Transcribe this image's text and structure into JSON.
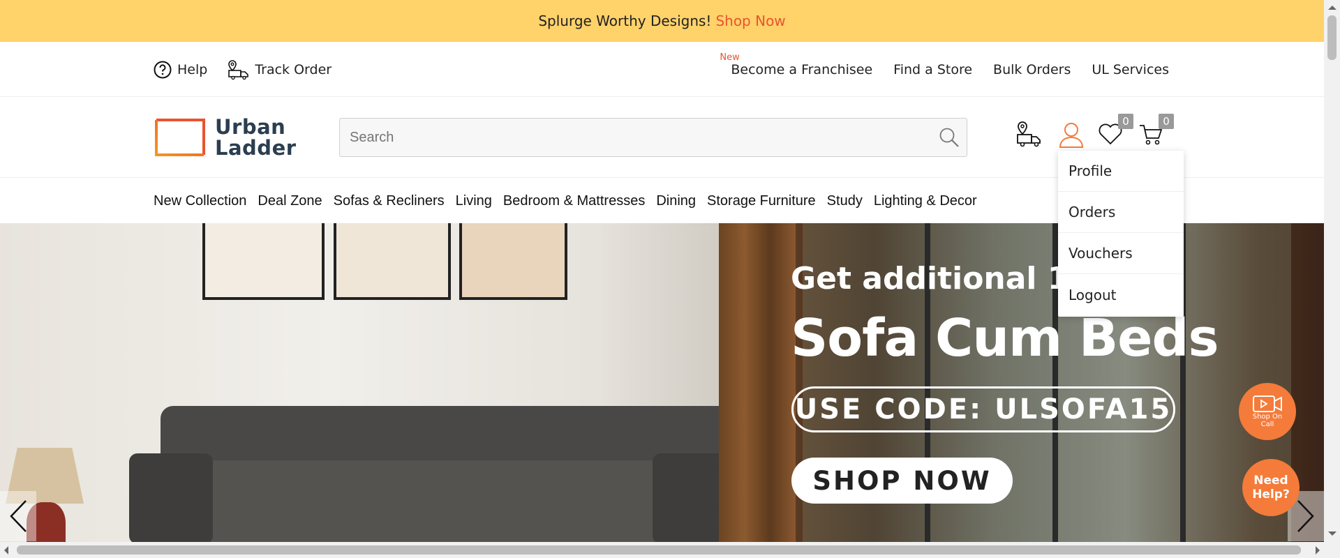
{
  "promo": {
    "text": "Splurge Worthy Designs!",
    "link": "Shop Now"
  },
  "util_left": [
    {
      "label": "Help",
      "icon": "help-icon"
    },
    {
      "label": "Track Order",
      "icon": "track-order-icon"
    }
  ],
  "util_right": {
    "new_tag": "New",
    "links": [
      "Become a Franchisee",
      "Find a Store",
      "Bulk Orders",
      "UL Services"
    ]
  },
  "logo": {
    "line1": "Urban",
    "line2": "Ladder"
  },
  "search": {
    "placeholder": "Search"
  },
  "header_icons": {
    "wishlist_count": "0",
    "cart_count": "0"
  },
  "categories": [
    "New Collection",
    "Deal Zone",
    "Sofas & Recliners",
    "Living",
    "Bedroom & Mattresses",
    "Dining",
    "Storage Furniture",
    "Study",
    "Lighting & Decor"
  ],
  "hero": {
    "subtitle": "Get additional 15%",
    "title": "Sofa Cum Beds",
    "code": "USE CODE: ULSOFA15",
    "cta": "SHOP NOW"
  },
  "account_menu": [
    "Profile",
    "Orders",
    "Vouchers",
    "Logout"
  ],
  "floating": {
    "shop_on_call": "Shop On Call",
    "need_help_line1": "Need",
    "need_help_line2": "Help?"
  },
  "colors": {
    "promo_bg": "#ffd26a",
    "accent": "#e8542f",
    "float_btn": "#f47b3a"
  }
}
